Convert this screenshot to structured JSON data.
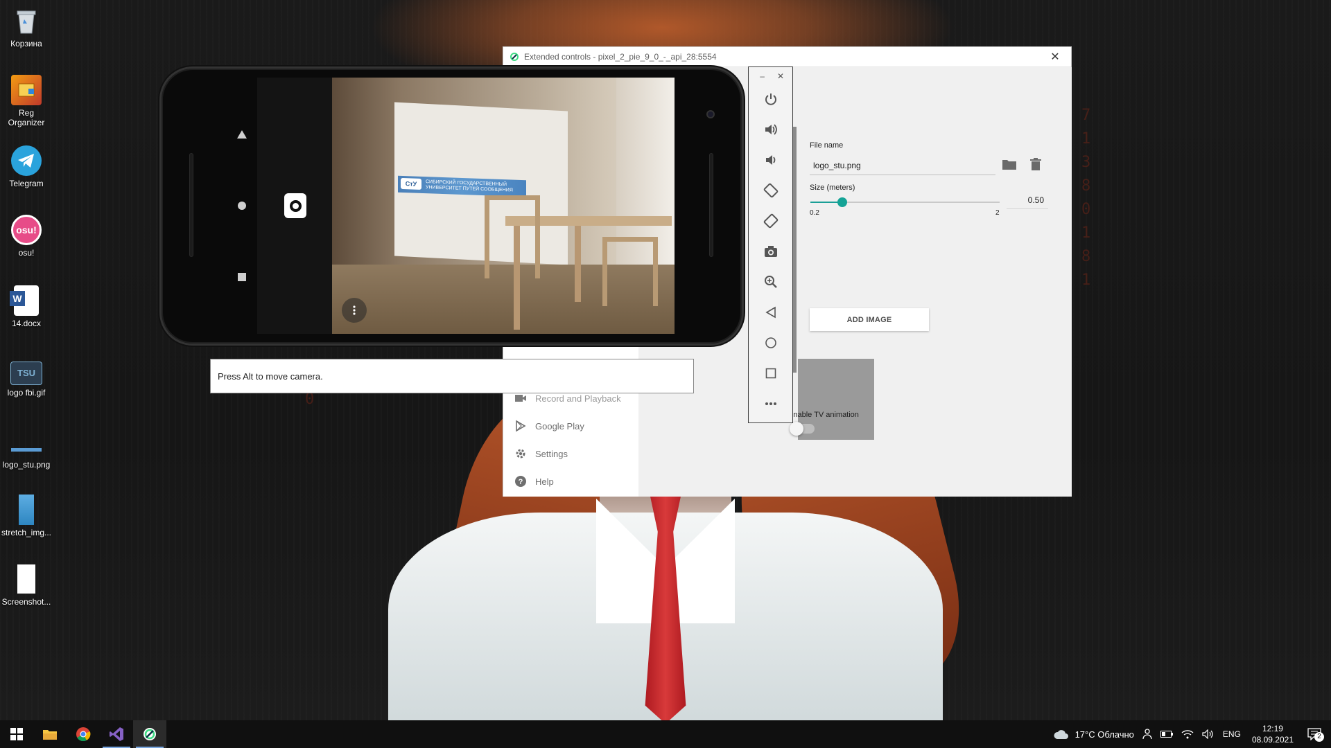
{
  "desktop": {
    "icons": [
      {
        "label": "Корзина"
      },
      {
        "label": "Reg Organizer"
      },
      {
        "label": "Telegram"
      },
      {
        "label": "osu!"
      },
      {
        "label": "14.docx"
      },
      {
        "label": "logo fbi.gif"
      },
      {
        "label": "logo_stu.png"
      },
      {
        "label": "stretch_img..."
      },
      {
        "label": "Screenshot..."
      }
    ],
    "osu_badge": "osu!",
    "word_badge": "W",
    "tsu_logo": "TSU"
  },
  "extended_controls": {
    "title": "Extended controls - pixel_2_pie_9_0_-_api_28:5554",
    "close_glyph": "✕",
    "nav": [
      {
        "label": "Record and Playback"
      },
      {
        "label": "Google Play"
      },
      {
        "label": "Settings"
      },
      {
        "label": "Help"
      }
    ],
    "file_name_label": "File name",
    "file_name_value": "logo_stu.png",
    "size_label": "Size (meters)",
    "size_min": "0.2",
    "size_max": "2",
    "size_value": "0.50",
    "size_fraction": 0.167,
    "add_image_label": "ADD IMAGE",
    "tv_animation_label": "Enable TV animation",
    "tv_animation_on": false
  },
  "emulator": {
    "tooltip": "Press Alt to move camera.",
    "board_logo": "СтУ",
    "board_text": "СИБИРСКИЙ ГОСУДАРСТВЕННЫЙ УНИВЕРСИТЕТ ПУТЕЙ СООБЩЕНИЯ",
    "toolbar": {
      "minimize_glyph": "–",
      "close_glyph": "✕",
      "buttons": [
        "power",
        "volume-up",
        "volume-down",
        "rotate-left",
        "rotate-right",
        "screenshot",
        "zoom",
        "back",
        "home",
        "overview",
        "more"
      ]
    }
  },
  "taskbar": {
    "weather": "17°C  Облачно",
    "language": "ENG",
    "time": "12:19",
    "date": "08.09.2021",
    "notification_count": "2"
  },
  "colors": {
    "accent": "#14a396",
    "taskbar": "#101010",
    "tie": "#c8222a"
  }
}
